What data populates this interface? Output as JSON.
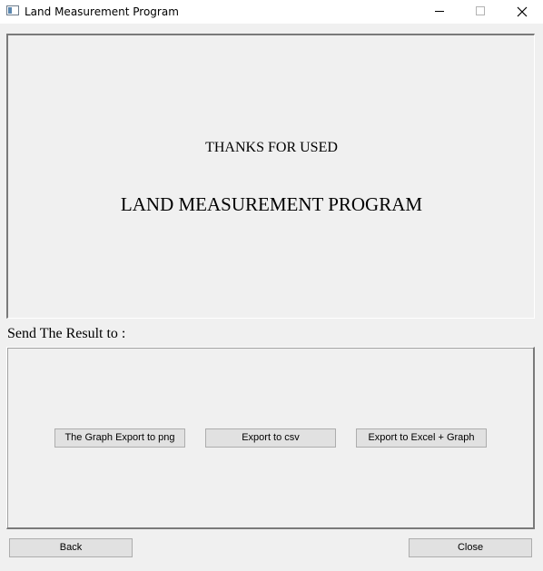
{
  "window": {
    "title": "Land Measurement Program",
    "icon": "app-window-icon",
    "controls": {
      "minimize_icon": "minimize-icon",
      "maximize_icon": "maximize-icon",
      "close_icon": "close-icon"
    }
  },
  "header_panel": {
    "thanks_text": "THANKS FOR USED",
    "program_text": "LAND MEASUREMENT PROGRAM"
  },
  "export": {
    "label": "Send The Result to :",
    "buttons": {
      "png": "The Graph Export to png",
      "csv": "Export to csv",
      "excel": "Export to Excel + Graph"
    }
  },
  "footer": {
    "back_label": "Back",
    "close_label": "Close"
  },
  "colors": {
    "window_background": "#f0f0f0",
    "titlebar_background": "#ffffff",
    "button_face": "#e1e1e1",
    "button_border": "#adadad"
  }
}
